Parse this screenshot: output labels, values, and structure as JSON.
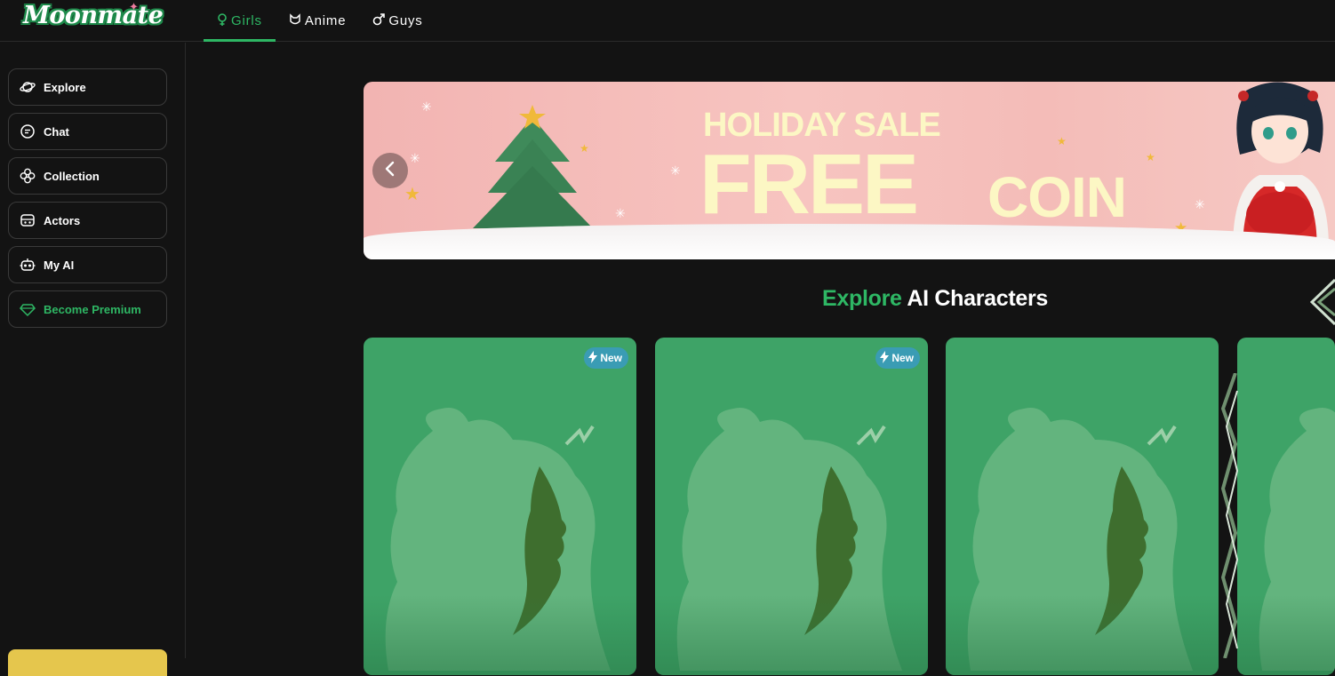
{
  "app": {
    "logo_text": "Moonmate",
    "brand_color": "#2eb764"
  },
  "tabs": [
    {
      "label": "Girls",
      "icon": "female-icon",
      "active": true
    },
    {
      "label": "Anime",
      "icon": "cat-mask-icon",
      "active": false
    },
    {
      "label": "Guys",
      "icon": "male-icon",
      "active": false
    }
  ],
  "sidebar": {
    "items": [
      {
        "label": "Explore",
        "icon": "planet-icon"
      },
      {
        "label": "Chat",
        "icon": "chat-bubble-icon"
      },
      {
        "label": "Collection",
        "icon": "collection-icon"
      },
      {
        "label": "Actors",
        "icon": "actor-icon"
      },
      {
        "label": "My AI",
        "icon": "robot-icon"
      },
      {
        "label": "Become Premium",
        "icon": "diamond-icon"
      }
    ]
  },
  "banner": {
    "line1": "HOLIDAY SALE",
    "line2": "FREE",
    "line3": "COIN",
    "prev_icon": "chevron-left-icon"
  },
  "section": {
    "title_accent": "Explore",
    "title_rest": " AI Characters"
  },
  "cards": [
    {
      "badge": "New"
    },
    {
      "badge": "New"
    },
    {
      "badge": ""
    },
    {
      "badge": ""
    }
  ]
}
